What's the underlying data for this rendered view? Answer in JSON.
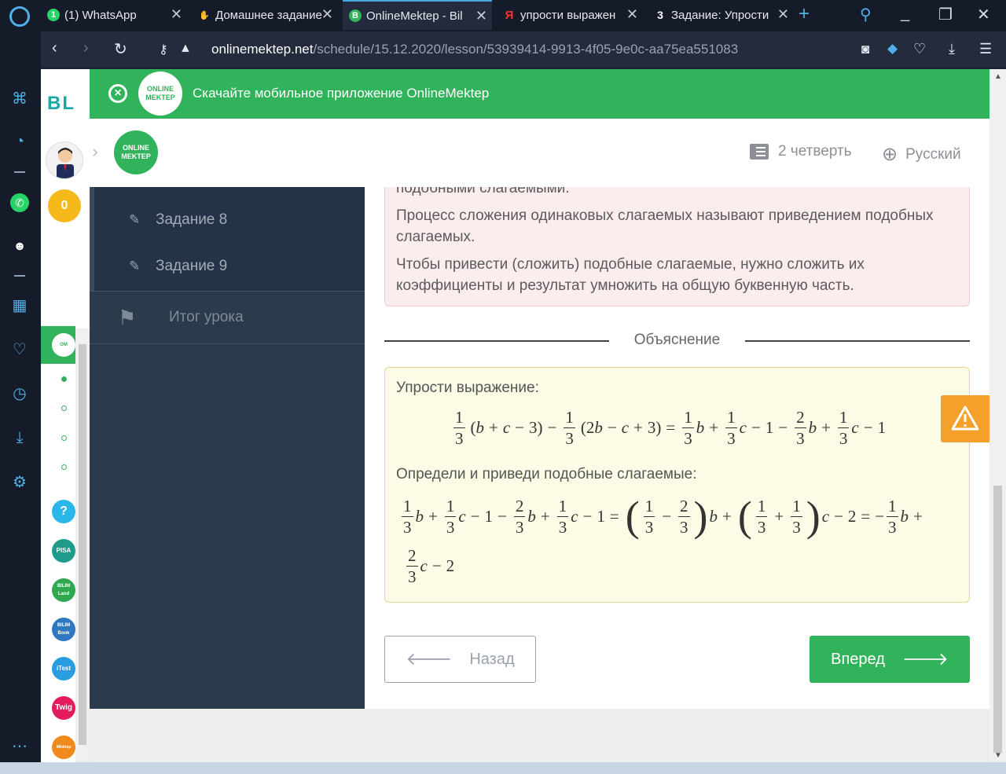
{
  "browser": {
    "tabs": [
      {
        "title": "(1) WhatsApp",
        "active": false,
        "icon": "whatsapp-icon"
      },
      {
        "title": "Домашнее задание",
        "active": false,
        "icon": "hand-icon"
      },
      {
        "title": "OnlineMektep - Bil",
        "active": true,
        "icon": "bilim-icon"
      },
      {
        "title": "упрости выражен",
        "active": false,
        "icon": "yandex-icon"
      },
      {
        "title": "Задание: Упрости",
        "active": false,
        "icon": "znanija-icon"
      }
    ],
    "url_domain": "onlinemektep.net",
    "url_path": "/schedule/15.12.2020/lesson/53939414-9913-4f05-9e0c-aa75ea551083"
  },
  "banner": {
    "text": "Скачайте мобильное приложение OnlineMektep",
    "logo_line1": "ONLINE",
    "logo_line2": "MEKTEP"
  },
  "header": {
    "logo_line1": "ONLINE",
    "logo_line2": "MEKTEP",
    "quarter": "2 четверть",
    "language": "Русский"
  },
  "sidebar": {
    "brand": "BL",
    "coins": "0",
    "apps": [
      "?",
      "PISA",
      "BILIM Land",
      "BILIM Book",
      "iTest",
      "Twig",
      "iMektep"
    ]
  },
  "lesson_nav": {
    "items": [
      "Задание 8",
      "Задание 9"
    ],
    "summary": "Итог урока"
  },
  "content": {
    "rule_cut": "подобными слагаемыми.",
    "rule_p1": "Процесс сложения одинаковых слагаемых называют приведением подобных слагаемых.",
    "rule_p2": "Чтобы привести (сложить) подобные слагаемые, нужно сложить их коэффициенты и результат умножить на общую буквенную часть.",
    "divider_label": "Объяснение",
    "expl_title": "Упрости выражение:",
    "expl_step2": "Определи и приведи подобные слагаемые:"
  },
  "buttons": {
    "back": "Назад",
    "next": "Вперед"
  },
  "colors": {
    "brand_green": "#30b35b",
    "warning_orange": "#f5a02b",
    "nav_dark": "#2c3b4b"
  }
}
